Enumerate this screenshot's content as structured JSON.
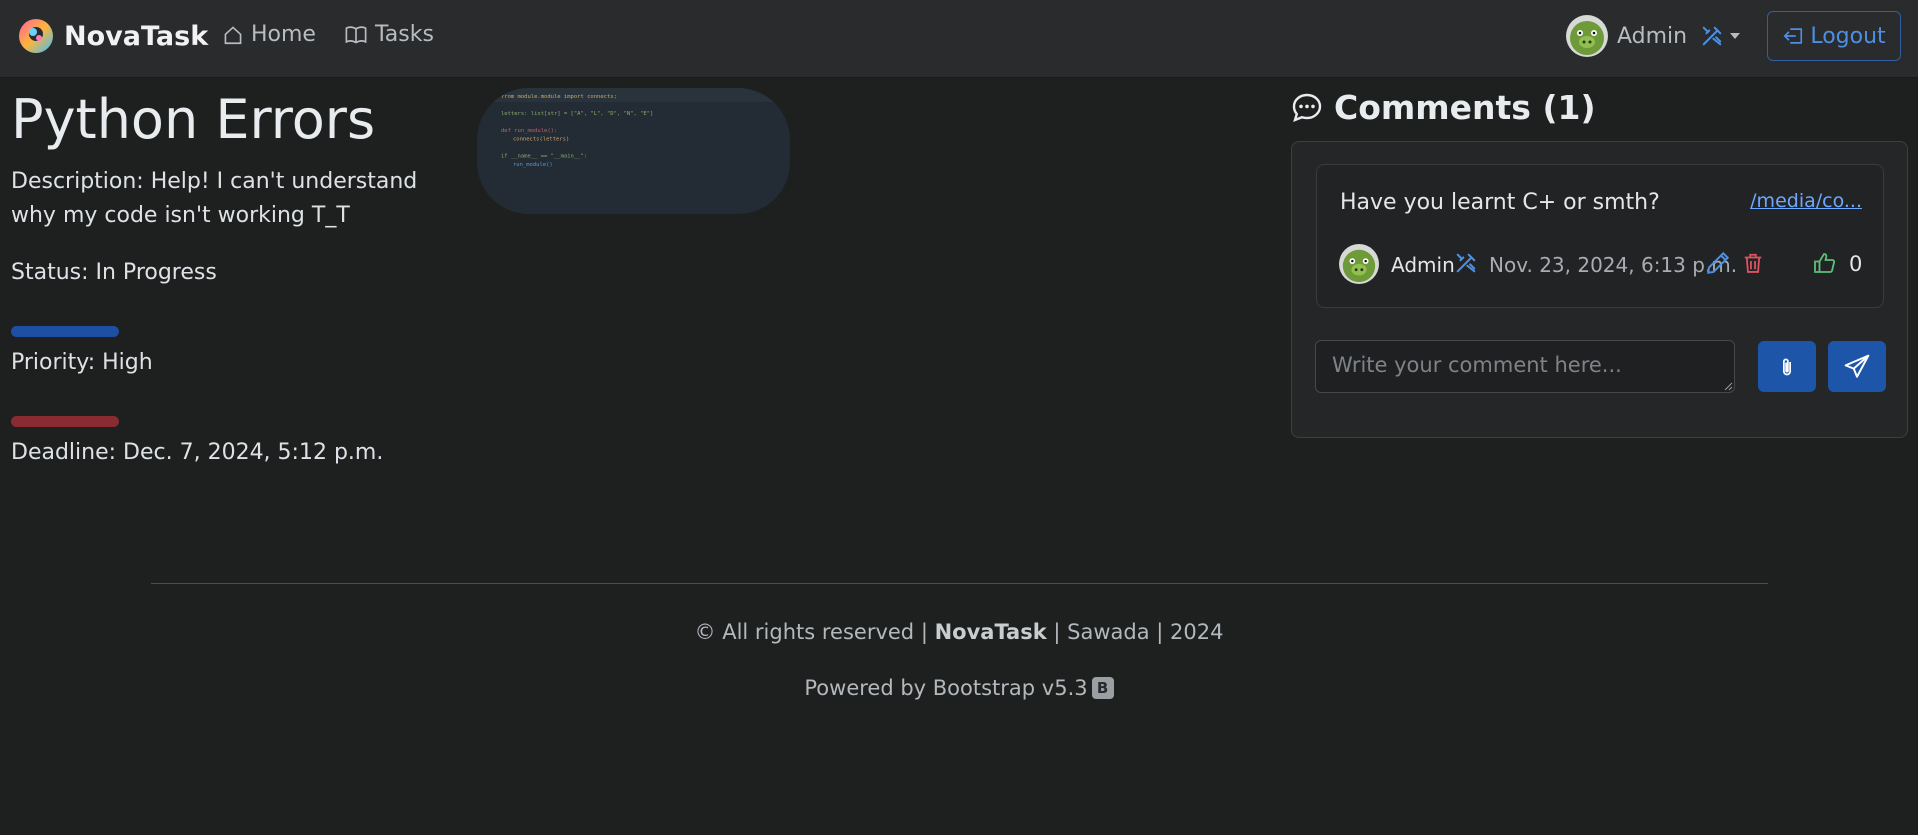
{
  "nav": {
    "brand": "NovaTask",
    "home_label": "Home",
    "tasks_label": "Tasks",
    "user_name": "Admin",
    "logout_label": "Logout"
  },
  "task": {
    "title": "Python Errors",
    "description": "Description: Help! I can't understand why my code isn't working T_T",
    "status": "Status: In Progress",
    "priority": "Priority: High",
    "deadline": "Deadline: Dec. 7, 2024, 5:12 p.m."
  },
  "attachment_code": [
    "from module.module import connects;",
    "",
    "letters: list[str] = [\"A\", \"L\", \"D\", \"N\", \"E\"]",
    "",
    "def run_module():",
    "    connects(letters)",
    "",
    "if __name__ == \"__main__\":",
    "    run_module()"
  ],
  "comments": {
    "heading": "Comments (1)",
    "items": [
      {
        "text": "Have you learnt C+ or smth?",
        "attachment_link": "/media/co...",
        "author": "Admin",
        "date": "Nov. 23, 2024, 6:13 p.m.",
        "likes": "0"
      }
    ],
    "input_placeholder": "Write your comment here..."
  },
  "footer": {
    "prefix": "© All rights reserved | ",
    "brand": "NovaTask",
    "suffix": " | Sawada | 2024",
    "powered_by": "Powered by Bootstrap v5.3",
    "badge": "B"
  },
  "colors": {
    "primary": "#1d56a8",
    "danger": "#e05260",
    "success": "#5cc079",
    "link": "#6ea8fe"
  }
}
